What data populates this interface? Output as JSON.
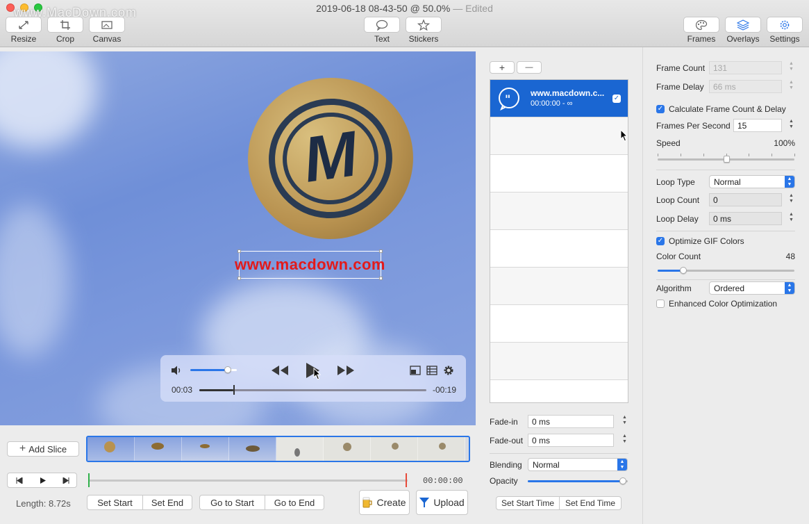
{
  "window": {
    "title": "2019-06-18 08-43-50 @ 50.0%",
    "edited": " — Edited",
    "watermark": "www.MacDown.com"
  },
  "toolbar": {
    "left": [
      {
        "label": "Resize",
        "icon": "resize-icon"
      },
      {
        "label": "Crop",
        "icon": "crop-icon"
      },
      {
        "label": "Canvas",
        "icon": "canvas-icon"
      }
    ],
    "center": [
      {
        "label": "Text",
        "icon": "speech-bubble-icon"
      },
      {
        "label": "Stickers",
        "icon": "star-icon"
      }
    ],
    "right": [
      {
        "label": "Frames",
        "icon": "palette-icon"
      },
      {
        "label": "Overlays",
        "icon": "layers-icon"
      },
      {
        "label": "Settings",
        "icon": "gear-icon"
      }
    ]
  },
  "canvas": {
    "overlay_text": "www.macdown.com",
    "coin_letter": "M"
  },
  "player": {
    "elapsed": "00:03",
    "remaining": "-00:19",
    "volume": 0.8,
    "progress": 0.15
  },
  "overlays": {
    "add_label": "+",
    "remove_label": "—",
    "items": [
      {
        "title": "www.macdown.c...",
        "subtitle": "00:00:00 - ∞",
        "checked": "✓"
      }
    ],
    "fade_in_label": "Fade-in",
    "fade_in": "0 ms",
    "fade_out_label": "Fade-out",
    "fade_out": "0 ms",
    "blending_label": "Blending",
    "blending": "Normal",
    "opacity_label": "Opacity",
    "opacity": 0.95,
    "set_start_time": "Set Start Time",
    "set_end_time": "Set End Time"
  },
  "settings": {
    "frame_count_label": "Frame Count",
    "frame_count": "131",
    "frame_delay_label": "Frame Delay",
    "frame_delay": "66 ms",
    "calc_label": "Calculate Frame Count & Delay",
    "fps_label": "Frames Per Second",
    "fps": "15",
    "speed_label": "Speed",
    "speed": "100%",
    "speed_value": 0.5,
    "loop_type_label": "Loop Type",
    "loop_type": "Normal",
    "loop_count_label": "Loop Count",
    "loop_count": "0",
    "loop_delay_label": "Loop Delay",
    "loop_delay": "0 ms",
    "optimize_label": "Optimize GIF Colors",
    "color_count_label": "Color Count",
    "color_count": "48",
    "color_count_value": 0.19,
    "algorithm_label": "Algorithm",
    "algorithm": "Ordered",
    "enhanced_label": "Enhanced Color Optimization"
  },
  "timeline": {
    "add_slice": "Add Slice",
    "time": "00:00:00",
    "length": "Length: 8.72s",
    "set_start": "Set Start",
    "set_end": "Set End",
    "go_to_start": "Go to Start",
    "go_to_end": "Go to End",
    "create": "Create",
    "upload": "Upload"
  }
}
